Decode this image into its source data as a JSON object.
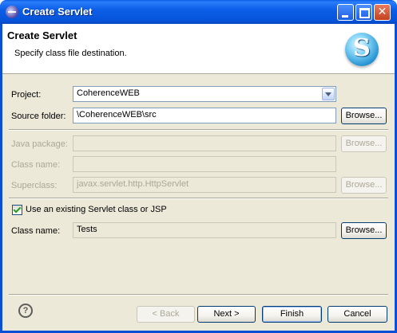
{
  "window": {
    "title": "Create Servlet"
  },
  "header": {
    "title": "Create Servlet",
    "description": "Specify class file destination.",
    "icon": "servlet-s-icon"
  },
  "form": {
    "project": {
      "label": "Project:",
      "value": "CoherenceWEB"
    },
    "source_folder": {
      "label": "Source folder:",
      "value": "\\CoherenceWEB\\src",
      "browse": "Browse..."
    },
    "java_package": {
      "label": "Java package:",
      "value": "",
      "browse": "Browse..."
    },
    "class_name": {
      "label": "Class name:",
      "value": ""
    },
    "superclass": {
      "label": "Superclass:",
      "value": "javax.servlet.http.HttpServlet",
      "browse": "Browse..."
    },
    "use_existing": {
      "label": "Use an existing Servlet class or JSP",
      "checked": true
    },
    "existing_class": {
      "label": "Class name:",
      "value": "Tests",
      "browse": "Browse..."
    }
  },
  "buttons": {
    "back": "< Back",
    "next": "Next >",
    "finish": "Finish",
    "cancel": "Cancel"
  }
}
